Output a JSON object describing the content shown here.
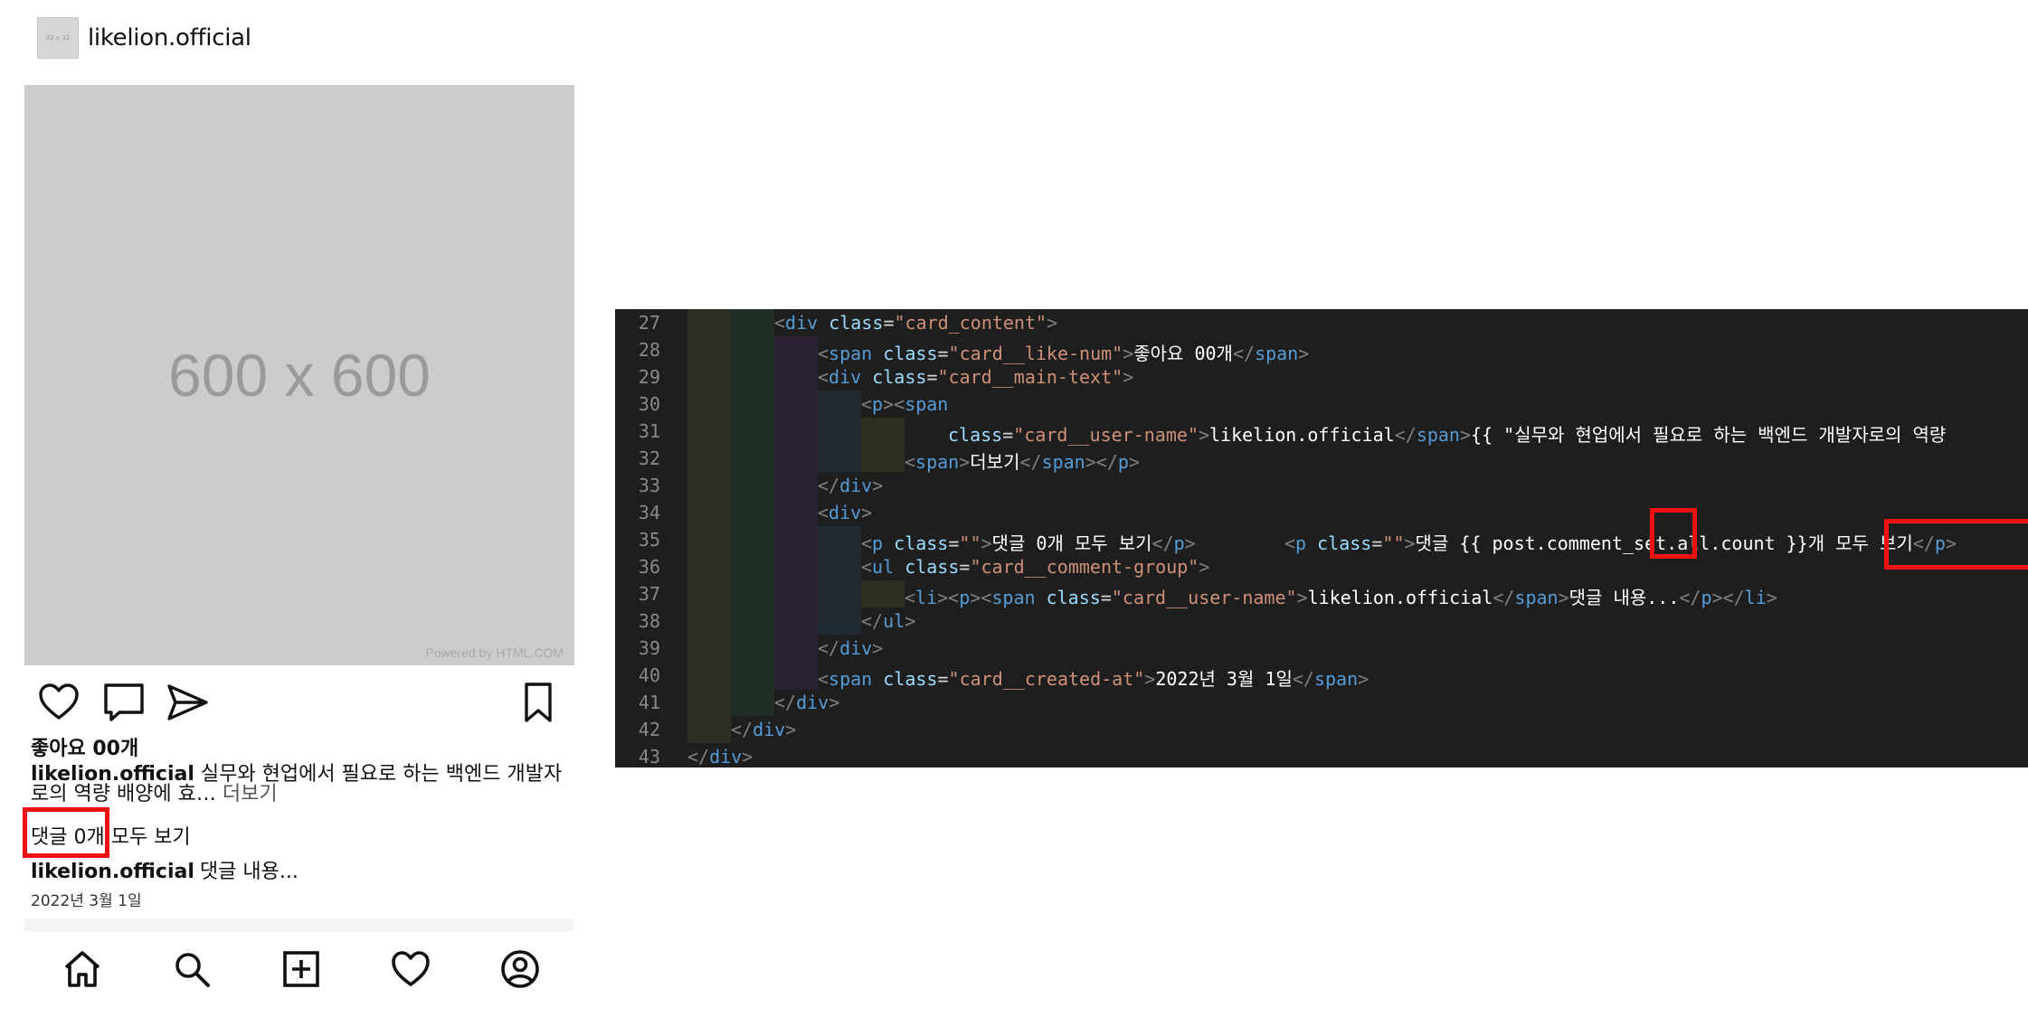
{
  "post": {
    "avatar_text": "32 x 32",
    "username": "likelion.official",
    "image_placeholder": "600 x 600",
    "image_credit": "Powered by HTML.COM",
    "likes": "좋아요 00개",
    "main_user": "likelion.official",
    "main_text": "실무와 현업에서 필요로 하는 백엔드 개발자로의 역량 배양에 효…",
    "more_label": "더보기",
    "comments_link": "댓글 0개 모두 보기",
    "comment_user": "likelion.official",
    "comment_text": "댓글 내용...",
    "created_at": "2022년 3월 1일"
  },
  "icons": {
    "actions": [
      "heart-icon",
      "comment-icon",
      "send-icon",
      "bookmark-icon"
    ],
    "nav": [
      "home-icon",
      "search-icon",
      "add-post-icon",
      "heart-icon",
      "profile-icon"
    ]
  },
  "editor": {
    "colors": {
      "background": "#1e1e1e",
      "tag": "#569cd6",
      "attr": "#9cdcfe",
      "string": "#ce9178",
      "text": "#ffffff",
      "highlight": "#ee1111"
    },
    "line_numbers": [
      "27",
      "28",
      "29",
      "30",
      "31",
      "32",
      "33",
      "34",
      "35",
      "36",
      "37",
      "38",
      "39",
      "40",
      "41",
      "42",
      "43"
    ],
    "cls": {
      "card_content": "\"card_content\"",
      "like_num": "\"card__like-num\"",
      "main_text": "\"card__main-text\"",
      "user_name": "\"card__user-name\"",
      "empty": "\"\"",
      "comment_group": "\"card__comment-group\"",
      "created_at": "\"card__created-at\""
    },
    "text": {
      "likes": "좋아요 00개",
      "username": "likelion.official",
      "main_text_start": "{{ \"실무와 현업에서 필요로 하는 백엔드 개발자로의 역량",
      "more": "더보기",
      "comments_before": "댓글 ",
      "comments_count": "0",
      "comments_after": "개 모두 보기",
      "comment_content": "댓글 내용...",
      "created": "2022년 3월 1일",
      "new_comments": "댓글 {{ post.comment_set.all.count }}개 모두 보기"
    }
  }
}
